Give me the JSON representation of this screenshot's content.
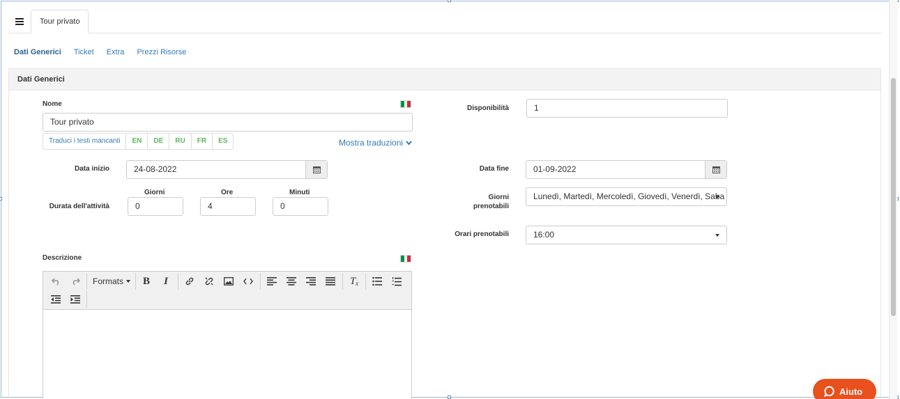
{
  "tab": {
    "menu_icon": "hamburger-icon",
    "title": "Tour privato"
  },
  "subnav": {
    "items": [
      "Dati Generici",
      "Ticket",
      "Extra",
      "Prezzi Risorse"
    ]
  },
  "panel": {
    "title": "Dati Generici"
  },
  "form": {
    "nome": {
      "label": "Nome",
      "value": "Tour privato"
    },
    "translate": {
      "button": "Traduci i testi mancanti",
      "langs": [
        "EN",
        "DE",
        "RU",
        "FR",
        "ES"
      ],
      "show": "Mostra traduzioni"
    },
    "data_inizio": {
      "label": "Data inizio",
      "value": "24-08-2022"
    },
    "durata": {
      "label": "Durata dell'attività",
      "giorni_label": "Giorni",
      "giorni": "0",
      "ore_label": "Ore",
      "ore": "4",
      "minuti_label": "Minuti",
      "minuti": "0"
    },
    "disponibilita": {
      "label": "Disponibilità",
      "value": "1"
    },
    "data_fine": {
      "label": "Data fine",
      "value": "01-09-2022"
    },
    "giorni_prenotabili": {
      "label_line1": "Giorni",
      "label_line2": "prenotabili",
      "value": "Lunedì, Martedì, Mercoledì, Giovedì, Venerdì, Saba"
    },
    "orari_prenotabili": {
      "label": "Orari prenotabili",
      "value": "16:00"
    },
    "descrizione": {
      "label": "Descrizione",
      "formats": "Formats"
    }
  },
  "help": {
    "label": "Aiuto"
  },
  "colors": {
    "link": "#337ab7",
    "green": "#5cb85c",
    "help": "#e8501e",
    "flag_green": "#009246",
    "flag_red": "#ce2b37"
  }
}
